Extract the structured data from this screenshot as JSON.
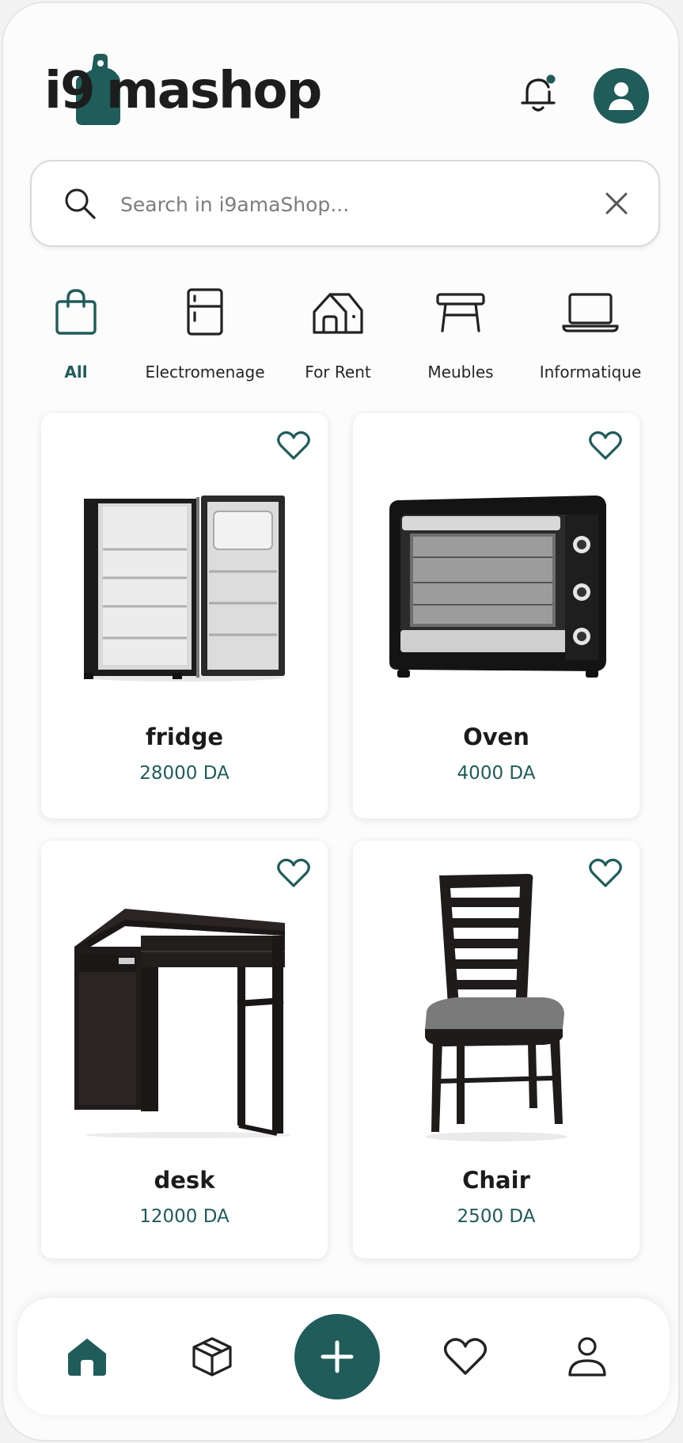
{
  "brand": {
    "name_prefix": "i9",
    "name_suffix": "mashop",
    "accent": "#1f5c5a",
    "dark": "#1d1d1d"
  },
  "header": {
    "notification_icon": "bell-icon",
    "profile_icon": "user-avatar-icon"
  },
  "search": {
    "placeholder": "Search in i9amaShop...",
    "value": "",
    "icon": "search-icon",
    "clear_icon": "close-icon"
  },
  "categories": [
    {
      "label": "All",
      "icon": "shopping-bag-icon",
      "active": true
    },
    {
      "label": "Electromenage",
      "icon": "fridge-icon",
      "active": false
    },
    {
      "label": "For Rent",
      "icon": "house-icon",
      "active": false
    },
    {
      "label": "Meubles",
      "icon": "table-icon",
      "active": false
    },
    {
      "label": "Informatique",
      "icon": "laptop-icon",
      "active": false
    }
  ],
  "products": [
    {
      "name": "fridge",
      "price": "28000 DA",
      "image": "fridge-image",
      "favorite_icon": "heart-icon"
    },
    {
      "name": "Oven",
      "price": "4000 DA",
      "image": "oven-image",
      "favorite_icon": "heart-icon"
    },
    {
      "name": "desk",
      "price": "12000 DA",
      "image": "desk-image",
      "favorite_icon": "heart-icon"
    },
    {
      "name": "Chair",
      "price": "2500 DA",
      "image": "chair-image",
      "favorite_icon": "heart-icon"
    }
  ],
  "bottom_nav": [
    {
      "icon": "home-icon",
      "active": true
    },
    {
      "icon": "box-icon",
      "active": false
    },
    {
      "icon": "plus-icon",
      "active": false
    },
    {
      "icon": "heart-icon",
      "active": false
    },
    {
      "icon": "user-icon",
      "active": false
    }
  ]
}
